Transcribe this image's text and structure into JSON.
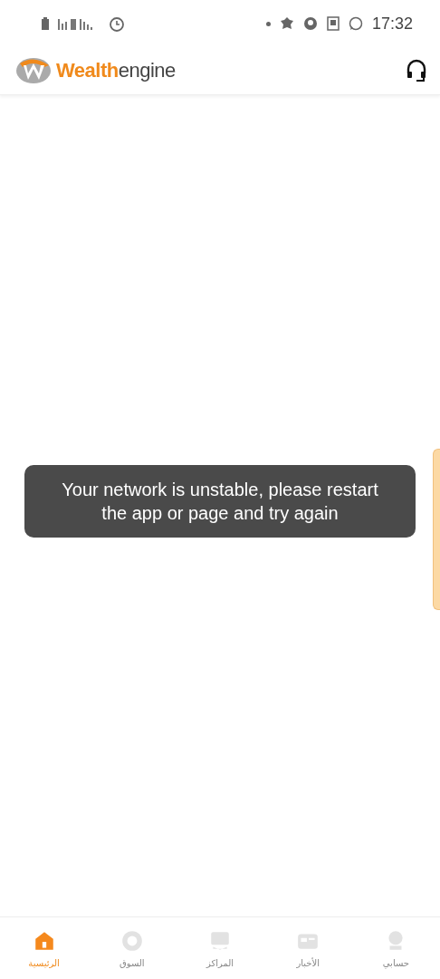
{
  "status_bar": {
    "time": "17:32"
  },
  "header": {
    "logo": "**Wealth**engine"
  },
  "toast": {
    "message": "Your network is unstable, please restart the app or page and try again"
  },
  "nav": [
    {
      "label": "حسابي",
      "kind": "account",
      "selected": false
    },
    {
      "label": "الأخبار",
      "kind": "news",
      "selected": false
    },
    {
      "label": "المراكز",
      "kind": "positions",
      "selected": false
    },
    {
      "label": "السوق",
      "kind": "market",
      "selected": false
    },
    {
      "label": "الرئيسية",
      "kind": "home",
      "selected": true
    }
  ]
}
